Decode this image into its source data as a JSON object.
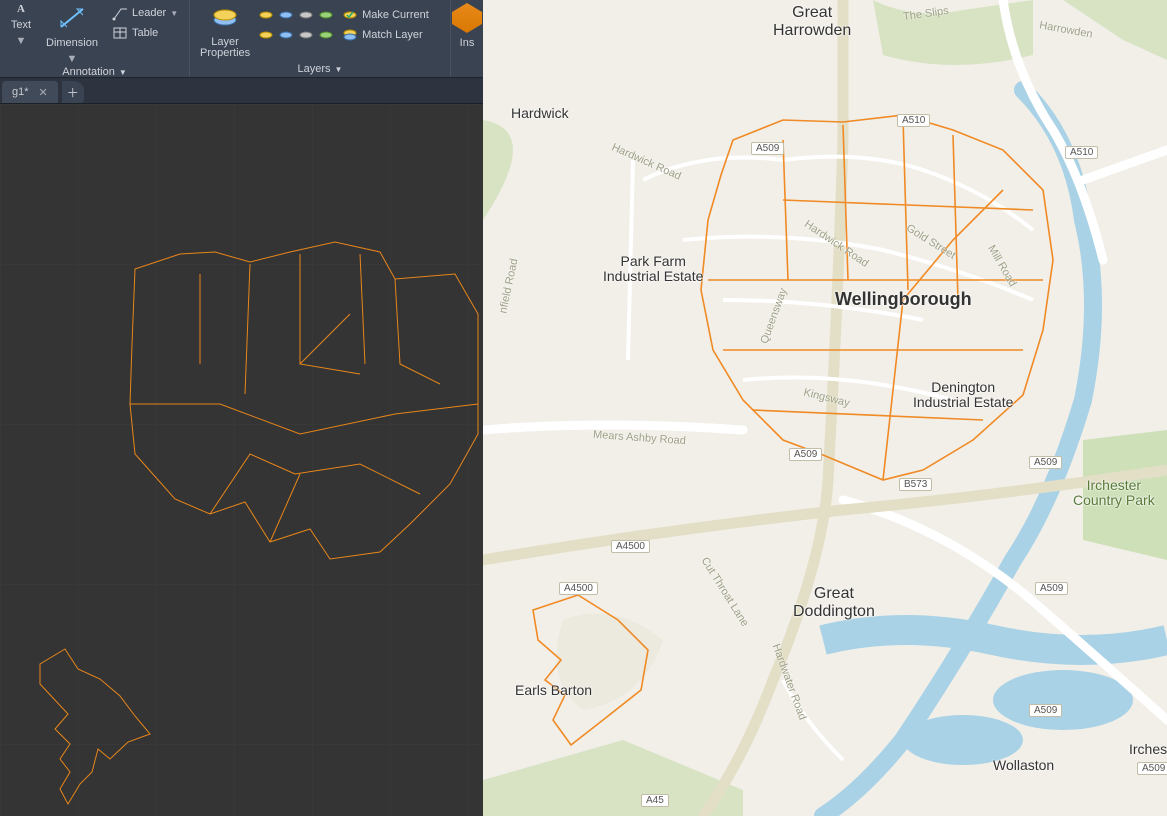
{
  "ribbon": {
    "text_btn": "Text",
    "dimension_btn": "Dimension",
    "leader_btn": "Leader",
    "table_btn": "Table",
    "annotation_panel": "Annotation",
    "layer_properties_btn": "Layer\nProperties",
    "make_current": "Make Current",
    "match_layer": "Match Layer",
    "layers_panel": "Layers",
    "insert_partial": "Ins"
  },
  "tabs": {
    "active": "g1*"
  },
  "map": {
    "places": {
      "gh": "Great\nHarrowden",
      "hw": "Hardwick",
      "pfie": "Park Farm\nIndustrial Estate",
      "wb": "Wellingborough",
      "die": "Denington\nIndustrial Estate",
      "gd": "Great\nDoddington",
      "eb": "Earls Barton",
      "wl": "Wollaston",
      "icp": "Irchester\nCountry Park",
      "irc": "Irches"
    },
    "roads": {
      "slips": "The Slips",
      "harrowden": "Harrowden",
      "hardwick": "Hardwick Road",
      "hardwick2": "Hardwick Road",
      "infield": "nfield Road",
      "gold": "Gold Street",
      "mill": "Mill Road",
      "queens": "Queensway",
      "kingsway": "Kingsway",
      "mears": "Mears Ashby Road",
      "cut": "Cut Throat Lane",
      "hardwater": "Hardwater Road"
    },
    "shields": {
      "a510a": "A510",
      "a510b": "A510",
      "a509a": "A509",
      "a509b": "A509",
      "a509c": "A509",
      "a509d": "A509",
      "a509e": "A509",
      "a509f": "A509",
      "b573": "B573",
      "a4500a": "A4500",
      "a4500b": "A4500",
      "a45": "A45"
    }
  }
}
